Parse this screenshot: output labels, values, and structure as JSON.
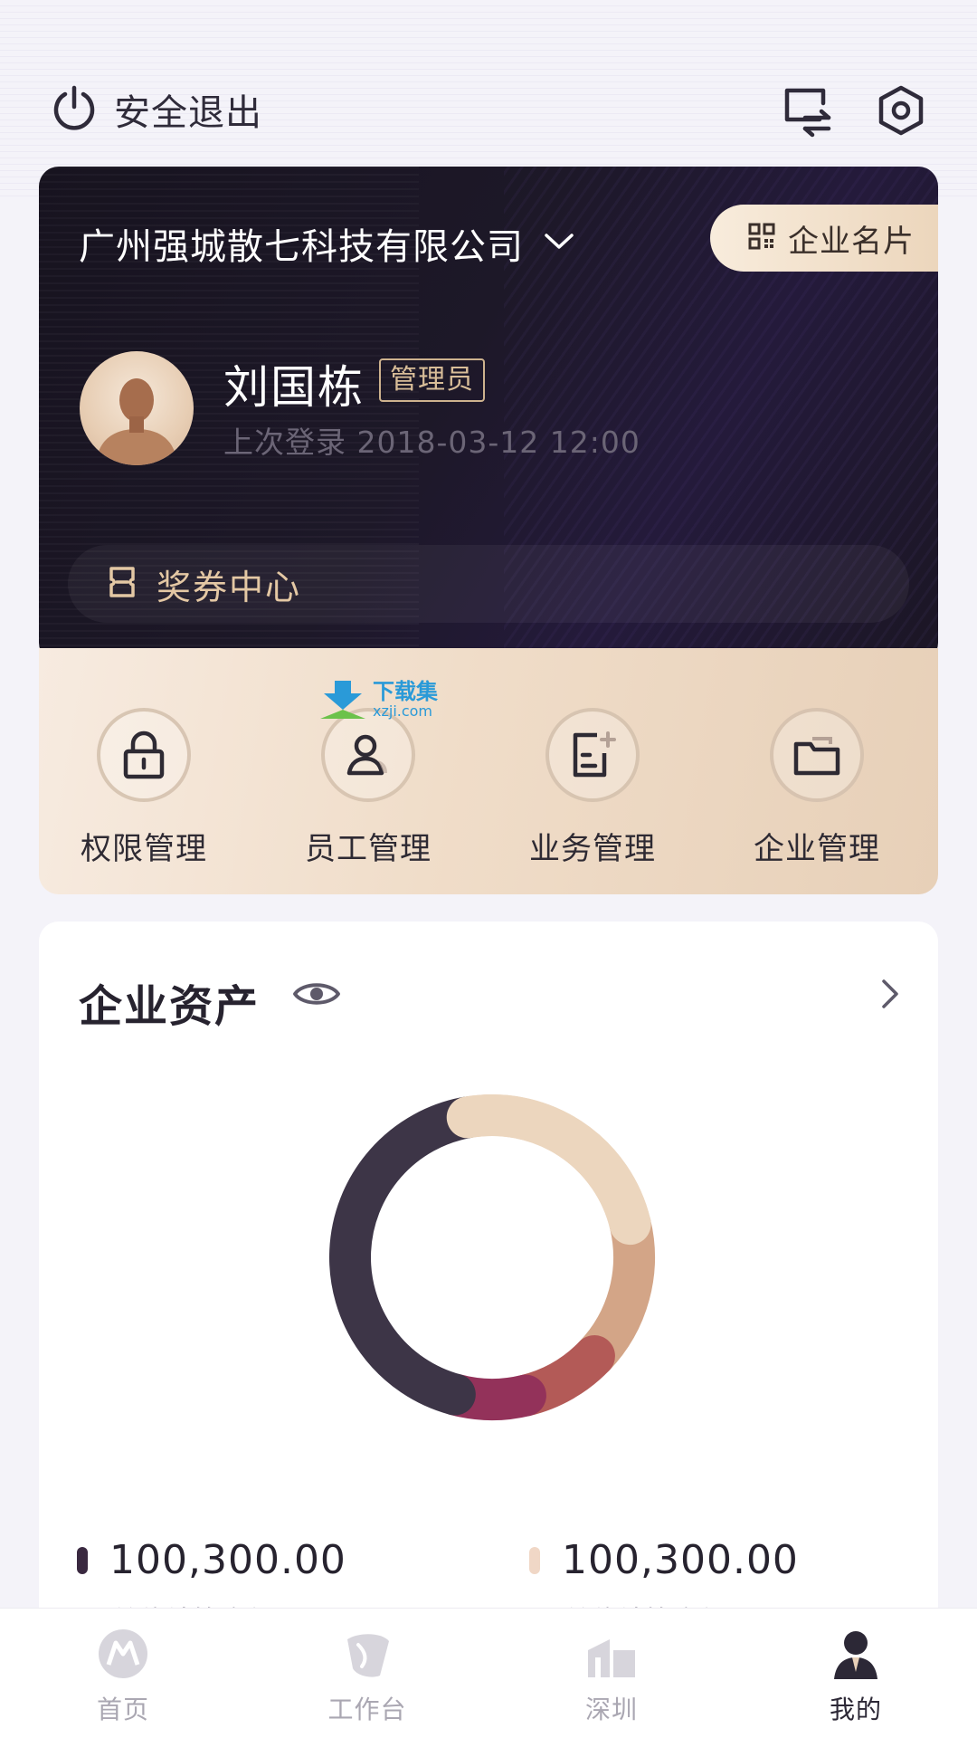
{
  "header": {
    "logout_label": "安全退出",
    "icons": [
      "power-icon",
      "switch-icon",
      "settings-icon"
    ]
  },
  "company_card": {
    "company_name": "广州强城散七科技有限公司",
    "business_card_label": "企业名片",
    "user_name": "刘国栋",
    "role": "管理员",
    "last_login": "上次登录 2018-03-12 12:00",
    "voucher_label": "奖券中心"
  },
  "management": {
    "items": [
      {
        "label": "权限管理",
        "icon": "lock-icon"
      },
      {
        "label": "员工管理",
        "icon": "user-icon"
      },
      {
        "label": "业务管理",
        "icon": "document-add-icon"
      },
      {
        "label": "企业管理",
        "icon": "folder-icon"
      }
    ]
  },
  "watermark": {
    "title": "下载集",
    "site": "xzji.com"
  },
  "assets": {
    "title": "企业资产",
    "stats": [
      {
        "value": "100,300.00",
        "label": "单位结算金额",
        "color": "#3a2940"
      },
      {
        "value": "100,300.00",
        "label": "单位结算金额",
        "color": "#f0d7c6"
      }
    ]
  },
  "chart_data": {
    "type": "pie",
    "donut": true,
    "slices": [
      {
        "value": 0.24,
        "color": "#ecd6be"
      },
      {
        "value": 0.16,
        "color": "#d3a587"
      },
      {
        "value": 0.09,
        "color": "#b35a57"
      },
      {
        "value": 0.08,
        "color": "#93325a"
      },
      {
        "value": 0.43,
        "color": "#3d3547"
      }
    ]
  },
  "bottom_nav": {
    "items": [
      {
        "label": "首页",
        "icon": "home-logo-icon"
      },
      {
        "label": "工作台",
        "icon": "workbench-icon"
      },
      {
        "label": "深圳",
        "icon": "city-icon"
      },
      {
        "label": "我的",
        "icon": "profile-icon",
        "active": true
      }
    ]
  },
  "colors": {
    "card_dark": "#1b1624",
    "gold_accent": "#e4c8a4",
    "panel_beige": "#f0ddc9",
    "background": "#f4f3f9"
  }
}
